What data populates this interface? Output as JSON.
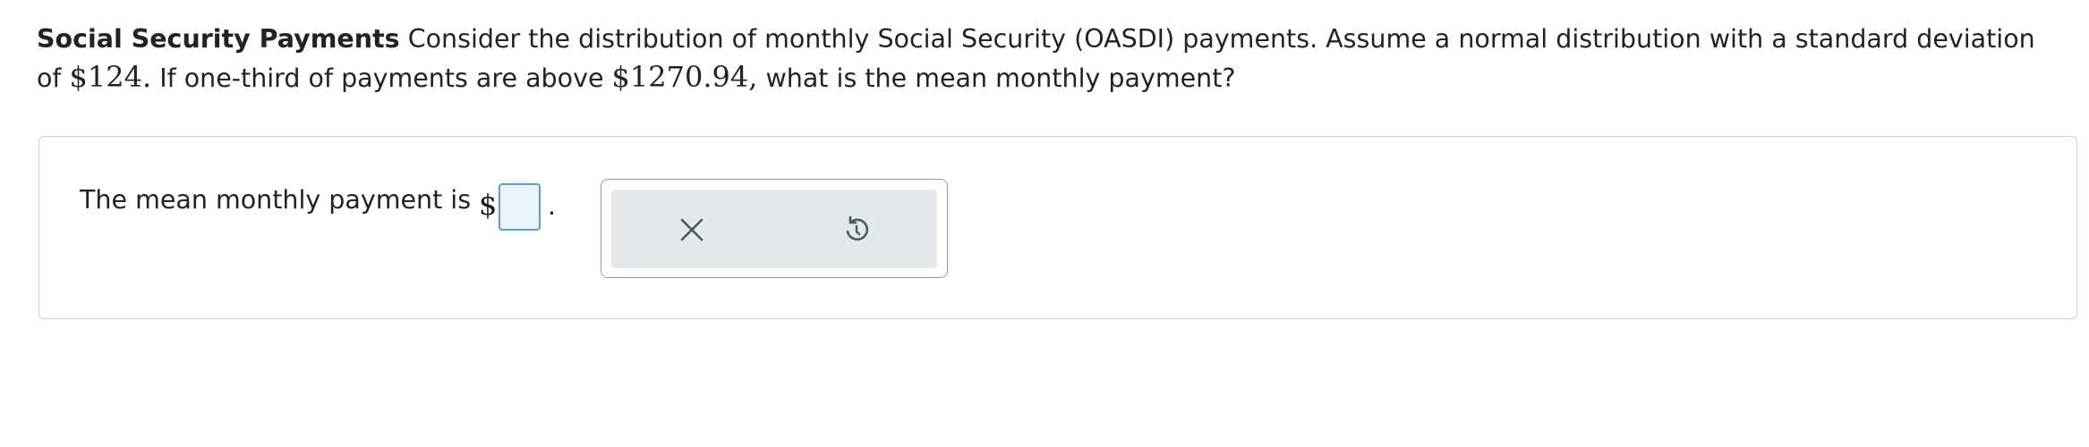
{
  "question": {
    "title": "Social Security Payments",
    "text_1": " Consider the distribution of monthly Social Security (OASDI) payments. Assume a normal distribution with a standard deviation of ",
    "sd_value": "$124.",
    "text_2": " If one-third of payments are above ",
    "threshold_value": "$1270.94,",
    "text_3": " what is the mean monthly payment?"
  },
  "answer": {
    "prompt": "The mean monthly payment is",
    "currency": "$",
    "input_value": "",
    "suffix": "."
  },
  "toolbar": {
    "clear_icon": "close-icon",
    "reset_icon": "undo-icon"
  },
  "colors": {
    "input_border": "#5aa3bf",
    "input_bg": "#e8f4fa",
    "toolbar_bg": "#e3e8ea",
    "icon_color": "#4a5a62"
  }
}
